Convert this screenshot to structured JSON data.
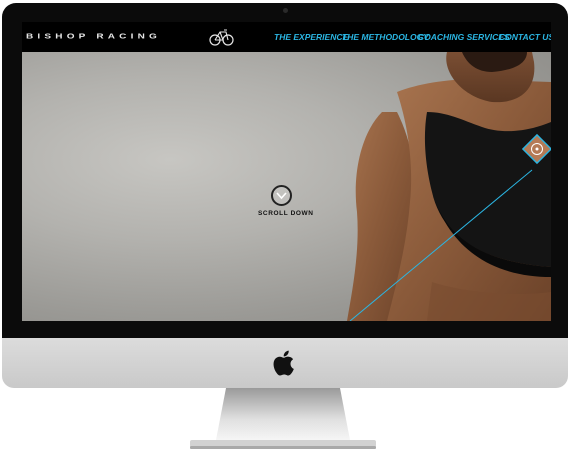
{
  "site": {
    "brand": "BISHOP RACING",
    "brand_icon": "bicycle-icon"
  },
  "nav": {
    "items": [
      {
        "label": "THE EXPERIENCE"
      },
      {
        "label": "THE METHODOLOGY"
      },
      {
        "label": "COACHING SERVICES"
      },
      {
        "label": "CONTACT US"
      }
    ]
  },
  "hero": {
    "scroll_label": "SCROLL DOWN",
    "scroll_icon": "chevron-down-icon",
    "hotspot_icon": "target-diamond-icon",
    "accent_color": "#2bb6e3"
  },
  "device": {
    "logo": "apple-logo-icon"
  }
}
